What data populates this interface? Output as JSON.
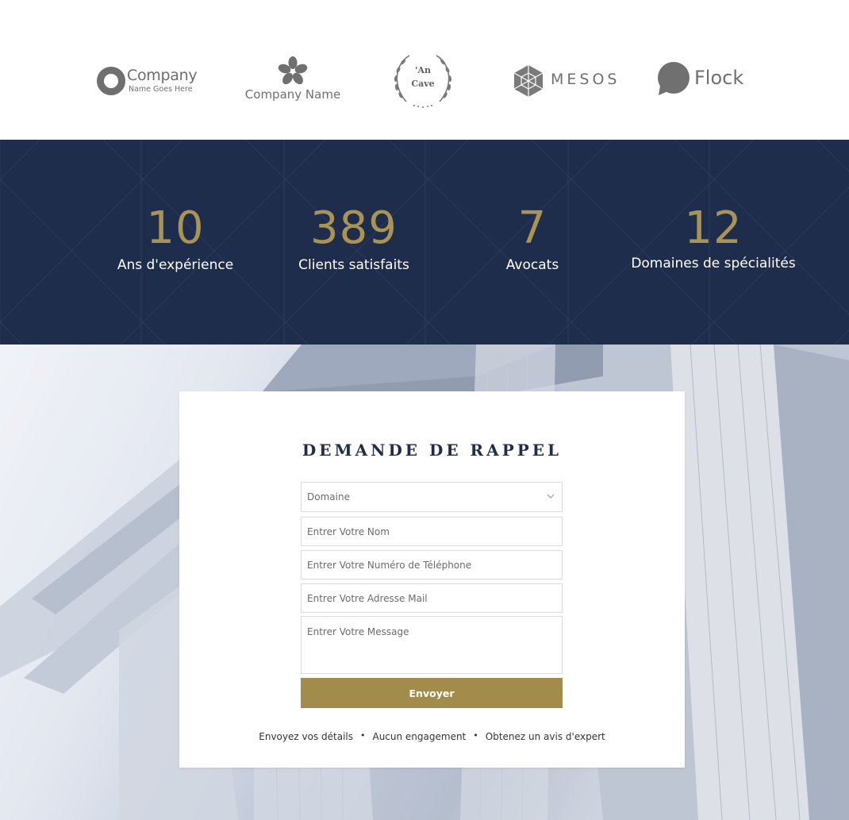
{
  "logos": [
    {
      "name": "Company",
      "tagline": "Name Goes Here"
    },
    {
      "name": "Company Name"
    },
    {
      "line1": "'An",
      "line2": "Cave"
    },
    {
      "name": "MESOS"
    },
    {
      "name": "Flock"
    }
  ],
  "stats": [
    {
      "value": "10",
      "label": "Ans d'expérience"
    },
    {
      "value": "389",
      "label": "Clients satisfaits"
    },
    {
      "value": "7",
      "label": "Avocats"
    },
    {
      "value": "12",
      "label": "Domaines de spécialités"
    }
  ],
  "form": {
    "title": "DEMANDE DE RAPPEL",
    "domain_select": "Domaine",
    "name_placeholder": "Entrer Votre Nom",
    "phone_placeholder": "Entrer Votre Numéro de Téléphone",
    "email_placeholder": "Entrer Votre Adresse Mail",
    "message_placeholder": "Entrer Votre Message",
    "submit_label": "Envoyer",
    "perks": [
      "Envoyez vos détails",
      "Aucun engagement",
      "Obtenez un avis d'expert"
    ]
  },
  "colors": {
    "navy": "#1f2d4d",
    "gold": "#a99453",
    "button_gold": "#a28c4b"
  },
  "icons": [
    "ring-logo-icon",
    "flower-logo-icon",
    "laurel-wreath-icon",
    "geodesic-logo-icon",
    "speech-bubble-logo-icon",
    "chevron-down-icon"
  ]
}
